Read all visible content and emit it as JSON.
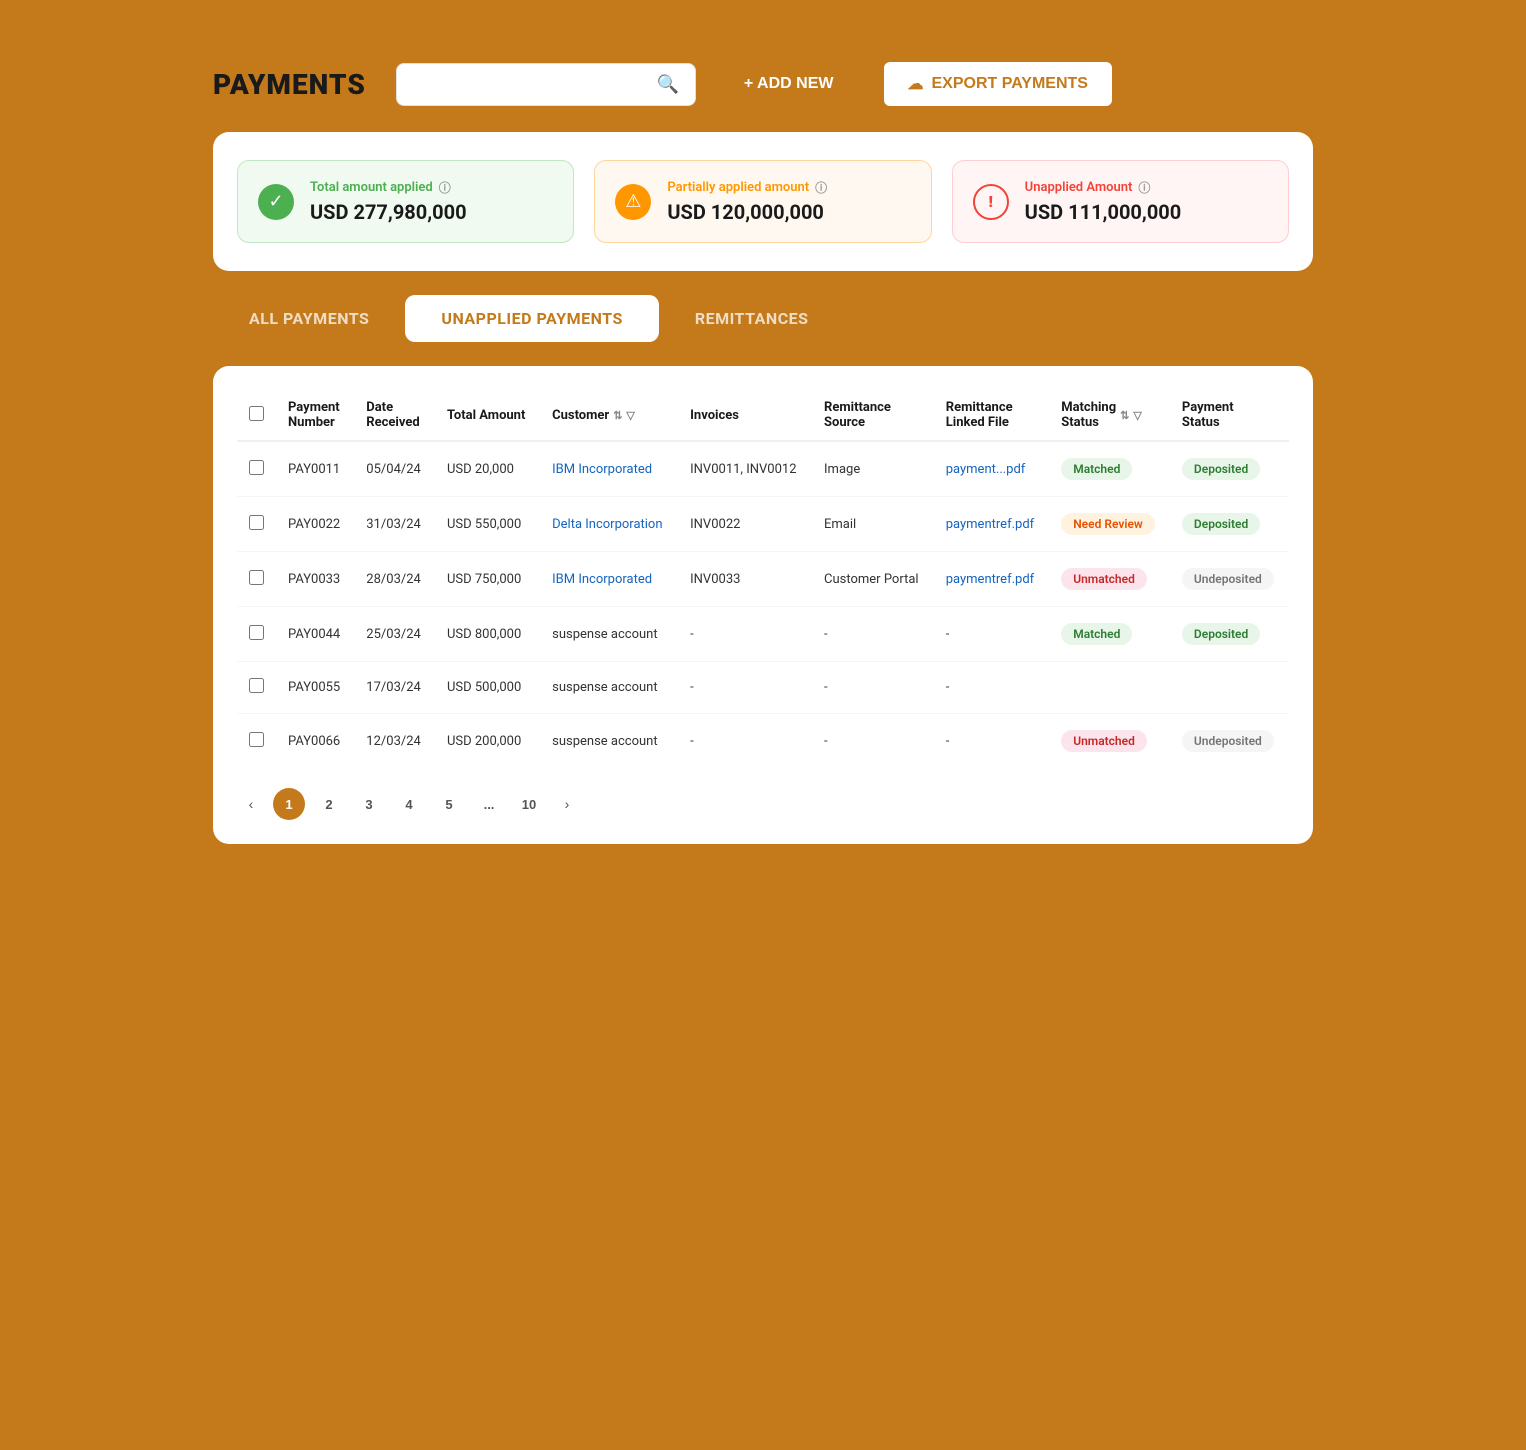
{
  "header": {
    "title": "PAYMENTS",
    "search_placeholder": "",
    "btn_add": "+ ADD NEW",
    "btn_export": "EXPORT PAYMENTS"
  },
  "summary": {
    "cards": [
      {
        "type": "green",
        "label": "Total amount applied",
        "value": "USD 277,980,000",
        "icon": "✓"
      },
      {
        "type": "orange",
        "label": "Partially applied amount",
        "value": "USD 120,000,000",
        "icon": "⚠"
      },
      {
        "type": "red",
        "label": "Unapplied Amount",
        "value": "USD 111,000,000",
        "icon": "!"
      }
    ]
  },
  "tabs": [
    {
      "label": "ALL PAYMENTS",
      "active": false
    },
    {
      "label": "UNAPPLIED PAYMENTS",
      "active": true
    },
    {
      "label": "REMITTANCES",
      "active": false
    }
  ],
  "table": {
    "columns": [
      {
        "id": "payment_number",
        "label": "Payment Number"
      },
      {
        "id": "date_received",
        "label": "Date Received"
      },
      {
        "id": "total_amount",
        "label": "Total Amount"
      },
      {
        "id": "customer",
        "label": "Customer"
      },
      {
        "id": "invoices",
        "label": "Invoices"
      },
      {
        "id": "remittance_source",
        "label": "Remittance Source"
      },
      {
        "id": "remittance_linked_file",
        "label": "Remittance Linked File"
      },
      {
        "id": "matching_status",
        "label": "Matching Status"
      },
      {
        "id": "payment_status",
        "label": "Payment Status"
      }
    ],
    "rows": [
      {
        "payment_number": "PAY0011",
        "date_received": "05/04/24",
        "total_amount": "USD 20,000",
        "customer": "IBM Incorporated",
        "customer_link": true,
        "invoices": "INV0011, INV0012",
        "remittance_source": "Image",
        "remittance_linked_file": "payment...pdf",
        "remittance_link": true,
        "matching_status": "Matched",
        "matching_badge": "matched",
        "payment_status": "Deposited",
        "payment_badge": "deposited"
      },
      {
        "payment_number": "PAY0022",
        "date_received": "31/03/24",
        "total_amount": "USD 550,000",
        "customer": "Delta Incorporation",
        "customer_link": true,
        "invoices": "INV0022",
        "remittance_source": "Email",
        "remittance_linked_file": "paymentref.pdf",
        "remittance_link": true,
        "matching_status": "Need Review",
        "matching_badge": "need-review",
        "payment_status": "Deposited",
        "payment_badge": "deposited"
      },
      {
        "payment_number": "PAY0033",
        "date_received": "28/03/24",
        "total_amount": "USD 750,000",
        "customer": "IBM Incorporated",
        "customer_link": true,
        "invoices": "INV0033",
        "remittance_source": "Customer Portal",
        "remittance_linked_file": "paymentref.pdf",
        "remittance_link": true,
        "matching_status": "Unmatched",
        "matching_badge": "unmatched",
        "payment_status": "Undeposited",
        "payment_badge": "undeposited"
      },
      {
        "payment_number": "PAY0044",
        "date_received": "25/03/24",
        "total_amount": "USD 800,000",
        "customer": "suspense account",
        "customer_link": false,
        "invoices": "-",
        "remittance_source": "-",
        "remittance_linked_file": "-",
        "remittance_link": false,
        "matching_status": "Matched",
        "matching_badge": "matched",
        "payment_status": "Deposited",
        "payment_badge": "deposited"
      },
      {
        "payment_number": "PAY0055",
        "date_received": "17/03/24",
        "total_amount": "USD 500,000",
        "customer": "suspense account",
        "customer_link": false,
        "invoices": "-",
        "remittance_source": "-",
        "remittance_linked_file": "-",
        "remittance_link": false,
        "matching_status": "",
        "matching_badge": "",
        "payment_status": "",
        "payment_badge": ""
      },
      {
        "payment_number": "PAY0066",
        "date_received": "12/03/24",
        "total_amount": "USD 200,000",
        "customer": "suspense account",
        "customer_link": false,
        "invoices": "-",
        "remittance_source": "-",
        "remittance_linked_file": "-",
        "remittance_link": false,
        "matching_status": "Unmatched",
        "matching_badge": "unmatched",
        "payment_status": "Undeposited",
        "payment_badge": "undeposited"
      }
    ]
  },
  "pagination": {
    "current": 1,
    "pages": [
      "1",
      "2",
      "3",
      "4",
      "5",
      "...",
      "10"
    ]
  }
}
